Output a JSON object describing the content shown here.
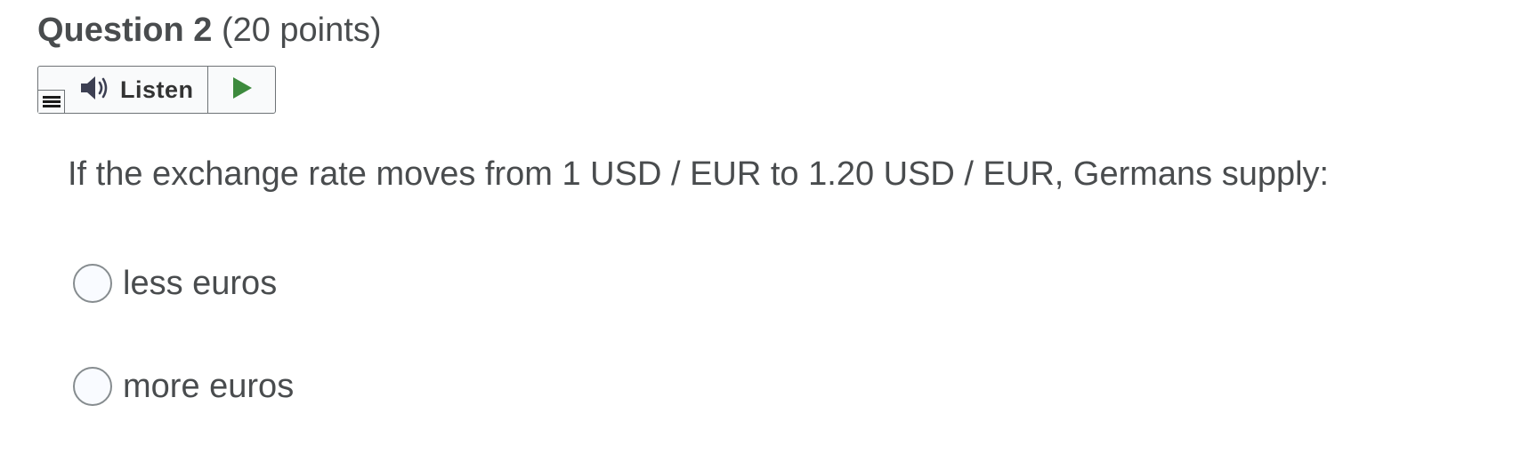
{
  "question": {
    "title": "Question 2",
    "points": "(20 points)",
    "text": "If the exchange rate moves from 1 USD / EUR to 1.20 USD / EUR, Germans supply:"
  },
  "listen": {
    "label": "Listen",
    "icons": {
      "menu": "menu-icon",
      "speaker": "speaker-icon",
      "play": "play-icon"
    },
    "colors": {
      "speaker": "#3c3f52",
      "play": "#3d8a3d"
    }
  },
  "options": [
    {
      "label": "less euros",
      "selected": false
    },
    {
      "label": "more euros",
      "selected": false
    }
  ]
}
